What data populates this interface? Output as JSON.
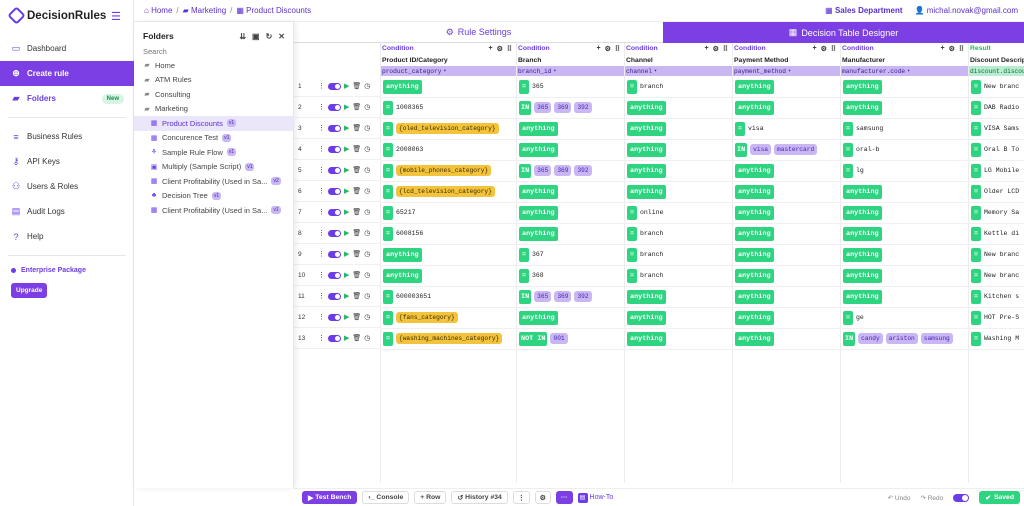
{
  "app": {
    "logo_text": "DecisionRules"
  },
  "nav": [
    {
      "label": "Dashboard",
      "icon": "monitor-icon"
    },
    {
      "label": "Create rule",
      "icon": "plus-circle-icon",
      "active": true
    },
    {
      "label": "Folders",
      "icon": "folder-icon",
      "badge": "New"
    },
    {
      "label": "Business Rules",
      "icon": "list-icon"
    },
    {
      "label": "API Keys",
      "icon": "key-icon"
    },
    {
      "label": "Users & Roles",
      "icon": "users-icon"
    },
    {
      "label": "Audit Logs",
      "icon": "file-icon"
    },
    {
      "label": "Help",
      "icon": "help-icon"
    }
  ],
  "enterprise": {
    "label": "Enterprise Package",
    "upgrade": "Upgrade"
  },
  "breadcrumb": [
    "Home",
    "Marketing",
    "Product Discounts"
  ],
  "topright": {
    "department": "Sales Department",
    "user": "michal.novak@gmail.com"
  },
  "folders": {
    "title": "Folders",
    "search_placeholder": "Search",
    "items": [
      {
        "label": "Home",
        "type": "folder",
        "level": 0
      },
      {
        "label": "ATM Rules",
        "type": "folder",
        "level": 0
      },
      {
        "label": "Consulting",
        "type": "folder",
        "level": 0
      },
      {
        "label": "Marketing",
        "type": "folder",
        "level": 0
      },
      {
        "label": "Product Discounts",
        "type": "table",
        "level": 1,
        "ver": "v1",
        "selected": true
      },
      {
        "label": "Concurence Test",
        "type": "table",
        "level": 1,
        "ver": "v1"
      },
      {
        "label": "Sample Rule Flow",
        "type": "flow",
        "level": 1,
        "ver": "v1"
      },
      {
        "label": "Multiply (Sample Script)",
        "type": "script",
        "level": 1,
        "ver": "v1"
      },
      {
        "label": "Client Profitability (Used in Sa...",
        "type": "table",
        "level": 1,
        "ver": "v2"
      },
      {
        "label": "Decision Tree",
        "type": "tree",
        "level": 1,
        "ver": "v1"
      },
      {
        "label": "Client Profitability (Used in Sa...",
        "type": "table",
        "level": 1,
        "ver": "v1"
      }
    ]
  },
  "tabs": {
    "rule_settings": "Rule Settings",
    "designer": "Decision Table Designer"
  },
  "table": {
    "columns": [
      {
        "kind": "Condition",
        "name": "Product ID/Category",
        "attr": "product_category"
      },
      {
        "kind": "Condition",
        "name": "Branch",
        "attr": "branch_id"
      },
      {
        "kind": "Condition",
        "name": "Channel",
        "attr": "channel"
      },
      {
        "kind": "Condition",
        "name": "Payment Method",
        "attr": "payment_method"
      },
      {
        "kind": "Condition",
        "name": "Manufacturer",
        "attr": "manufacturer.code"
      },
      {
        "kind": "Result",
        "name": "Discount Descrip",
        "attr": "discount.discou"
      }
    ],
    "rows": [
      [
        {
          "t": "any"
        },
        {
          "t": "op",
          "op": "=",
          "v": "365"
        },
        {
          "t": "op",
          "op": "=",
          "v": "branch"
        },
        {
          "t": "any"
        },
        {
          "t": "any"
        },
        {
          "t": "op",
          "op": "=",
          "v": "New branc"
        }
      ],
      [
        {
          "t": "op",
          "op": "=",
          "v": "1008365"
        },
        {
          "t": "op",
          "op": "IN",
          "chips": [
            "365",
            "369",
            "392"
          ]
        },
        {
          "t": "any"
        },
        {
          "t": "any"
        },
        {
          "t": "any"
        },
        {
          "t": "op",
          "op": "=",
          "v": "DAB Radio"
        }
      ],
      [
        {
          "t": "op",
          "op": "=",
          "y": "{oled_television_category}"
        },
        {
          "t": "any"
        },
        {
          "t": "any"
        },
        {
          "t": "op",
          "op": "=",
          "v": "visa"
        },
        {
          "t": "op",
          "op": "=",
          "v": "samsung"
        },
        {
          "t": "op",
          "op": "=",
          "v": "VISA Sams"
        }
      ],
      [
        {
          "t": "op",
          "op": "=",
          "v": "2008063"
        },
        {
          "t": "any"
        },
        {
          "t": "any"
        },
        {
          "t": "op",
          "op": "IN",
          "chips": [
            "visa",
            "mastercard"
          ]
        },
        {
          "t": "op",
          "op": "=",
          "v": "oral-b"
        },
        {
          "t": "op",
          "op": "=",
          "v": "Oral B To"
        }
      ],
      [
        {
          "t": "op",
          "op": "=",
          "y": "{mobile_phones_category}"
        },
        {
          "t": "op",
          "op": "IN",
          "chips": [
            "365",
            "369",
            "392"
          ]
        },
        {
          "t": "any"
        },
        {
          "t": "any"
        },
        {
          "t": "op",
          "op": "=",
          "v": "lg"
        },
        {
          "t": "op",
          "op": "=",
          "v": "LG Mobile"
        }
      ],
      [
        {
          "t": "op",
          "op": "=",
          "y": "{lcd_television_category}"
        },
        {
          "t": "any"
        },
        {
          "t": "any"
        },
        {
          "t": "any"
        },
        {
          "t": "any"
        },
        {
          "t": "op",
          "op": "=",
          "v": "Older LCD"
        }
      ],
      [
        {
          "t": "op",
          "op": "=",
          "v": "65217"
        },
        {
          "t": "any"
        },
        {
          "t": "op",
          "op": "=",
          "v": "online"
        },
        {
          "t": "any"
        },
        {
          "t": "any"
        },
        {
          "t": "op",
          "op": "=",
          "v": "Memory Sa"
        }
      ],
      [
        {
          "t": "op",
          "op": "=",
          "v": "6008156"
        },
        {
          "t": "any"
        },
        {
          "t": "op",
          "op": "=",
          "v": "branch"
        },
        {
          "t": "any"
        },
        {
          "t": "any"
        },
        {
          "t": "op",
          "op": "=",
          "v": "Kettle di"
        }
      ],
      [
        {
          "t": "any"
        },
        {
          "t": "op",
          "op": "=",
          "v": "367"
        },
        {
          "t": "op",
          "op": "=",
          "v": "branch"
        },
        {
          "t": "any"
        },
        {
          "t": "any"
        },
        {
          "t": "op",
          "op": "=",
          "v": "New branc"
        }
      ],
      [
        {
          "t": "any"
        },
        {
          "t": "op",
          "op": "=",
          "v": "368"
        },
        {
          "t": "op",
          "op": "=",
          "v": "branch"
        },
        {
          "t": "any"
        },
        {
          "t": "any"
        },
        {
          "t": "op",
          "op": "=",
          "v": "New branc"
        }
      ],
      [
        {
          "t": "op",
          "op": "=",
          "v": "600003651"
        },
        {
          "t": "op",
          "op": "IN",
          "chips": [
            "365",
            "369",
            "392"
          ]
        },
        {
          "t": "any"
        },
        {
          "t": "any"
        },
        {
          "t": "any"
        },
        {
          "t": "op",
          "op": "=",
          "v": "Kitchen s"
        }
      ],
      [
        {
          "t": "op",
          "op": "=",
          "y": "{fans_category}"
        },
        {
          "t": "any"
        },
        {
          "t": "any"
        },
        {
          "t": "any"
        },
        {
          "t": "op",
          "op": "=",
          "v": "ge"
        },
        {
          "t": "op",
          "op": "=",
          "v": "HOT Pre-S"
        }
      ],
      [
        {
          "t": "op",
          "op": "=",
          "y": "{washing_machines_category}"
        },
        {
          "t": "op",
          "op": "NOT IN",
          "chips": [
            "001"
          ]
        },
        {
          "t": "any"
        },
        {
          "t": "any"
        },
        {
          "t": "op",
          "op": "IN",
          "chips": [
            "candy",
            "ariston",
            "samsung"
          ]
        },
        {
          "t": "op",
          "op": "=",
          "v": "Washing M"
        }
      ]
    ],
    "any_label": "anything"
  },
  "bottombar": {
    "test_bench": "Test Bench",
    "console": "Console",
    "row": "+ Row",
    "history": "History #34",
    "how_to": "How-To",
    "undo": "Undo",
    "redo": "Redo",
    "saved": "Saved"
  },
  "colors": {
    "accent": "#7b3fe4",
    "green": "#2ed47f",
    "chip": "#c9b7f3",
    "yellow": "#f3c33b"
  }
}
